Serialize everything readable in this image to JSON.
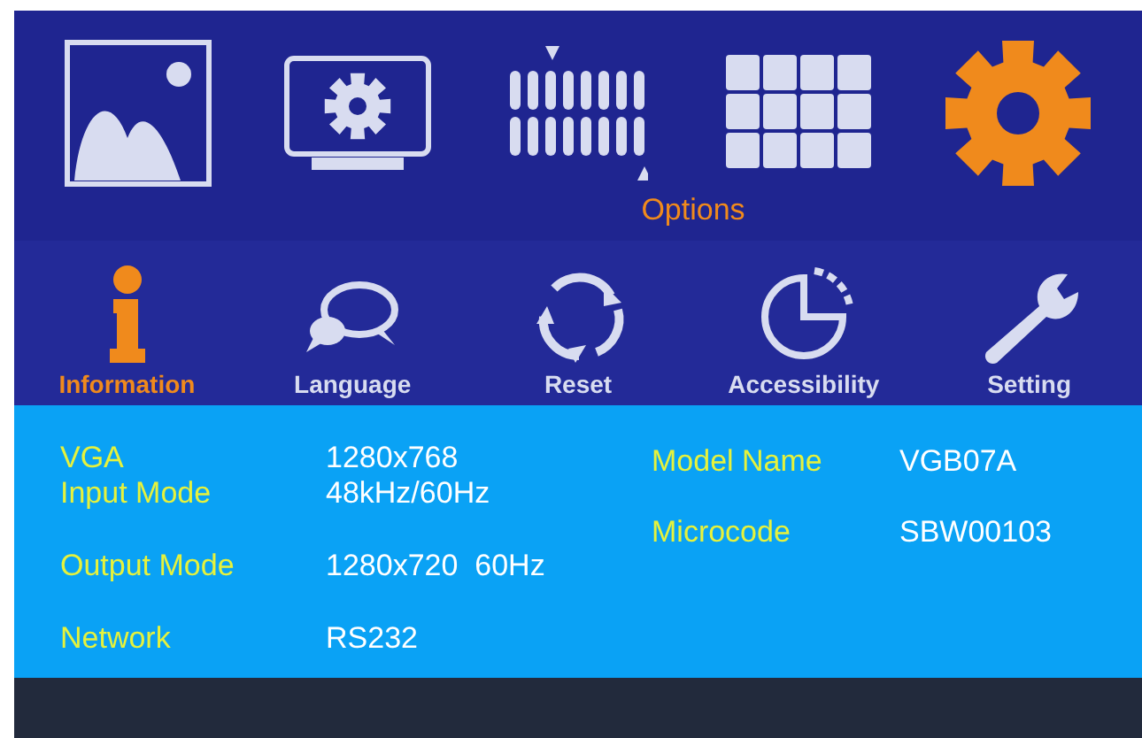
{
  "top_menu": {
    "items": [
      {
        "kind": "picture",
        "selected": false
      },
      {
        "kind": "display",
        "selected": false
      },
      {
        "kind": "pixels",
        "selected": false
      },
      {
        "kind": "grid",
        "selected": false
      },
      {
        "kind": "gear",
        "selected": true
      }
    ],
    "caption": "Options"
  },
  "tabs": [
    {
      "kind": "info",
      "label": "Information",
      "selected": true
    },
    {
      "kind": "chat",
      "label": "Language",
      "selected": false
    },
    {
      "kind": "reset",
      "label": "Reset",
      "selected": false
    },
    {
      "kind": "pie",
      "label": "Accessibility",
      "selected": false
    },
    {
      "kind": "wrench",
      "label": "Setting",
      "selected": false
    }
  ],
  "info_left": [
    {
      "label": "VGA",
      "value": "1280x768"
    },
    {
      "label": "Input Mode",
      "value": "48kHz/60Hz"
    },
    {
      "label": "Output Mode",
      "value": "1280x720  60Hz"
    },
    {
      "label": "Network",
      "value": "RS232"
    }
  ],
  "info_right": [
    {
      "label": "Model Name",
      "value": "VGB07A"
    },
    {
      "label": "Microcode",
      "value": "SBW00103"
    }
  ]
}
